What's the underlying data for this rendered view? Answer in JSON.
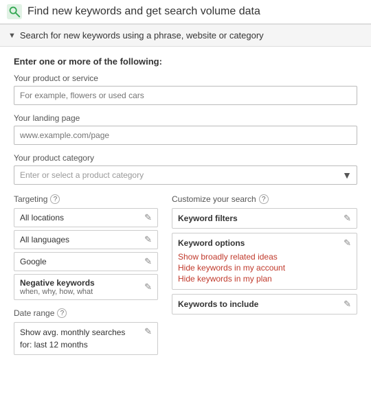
{
  "header": {
    "title": "Find new keywords and get search volume data",
    "icon_label": "search-icon"
  },
  "section": {
    "label": "Search for new keywords using a phrase, website or category"
  },
  "form": {
    "enter_label": "Enter one or more of the following:",
    "product_label": "Your product or service",
    "product_placeholder": "For example, flowers or used cars",
    "landing_label": "Your landing page",
    "landing_placeholder": "www.example.com/page",
    "category_label": "Your product category",
    "category_placeholder": "Enter or select a product category"
  },
  "targeting": {
    "label": "Targeting",
    "help": "?",
    "rows": [
      {
        "text": "All locations",
        "bold": false
      },
      {
        "text": "All languages",
        "bold": false
      },
      {
        "text": "Google",
        "bold": false
      },
      {
        "text": "Negative keywords",
        "bold": true,
        "sub": "when, why, how, what"
      }
    ]
  },
  "date_range": {
    "label": "Date range",
    "help": "?",
    "value_line1": "Show avg. monthly searches",
    "value_line2": "for: last 12 months"
  },
  "customize": {
    "label": "Customize your search",
    "help": "?",
    "blocks": [
      {
        "title": "Keyword filters",
        "links": []
      },
      {
        "title": "Keyword options",
        "links": [
          "Show broadly related ideas",
          "Hide keywords in my account",
          "Hide keywords in my plan"
        ]
      },
      {
        "title": "Keywords to include",
        "links": []
      }
    ]
  }
}
